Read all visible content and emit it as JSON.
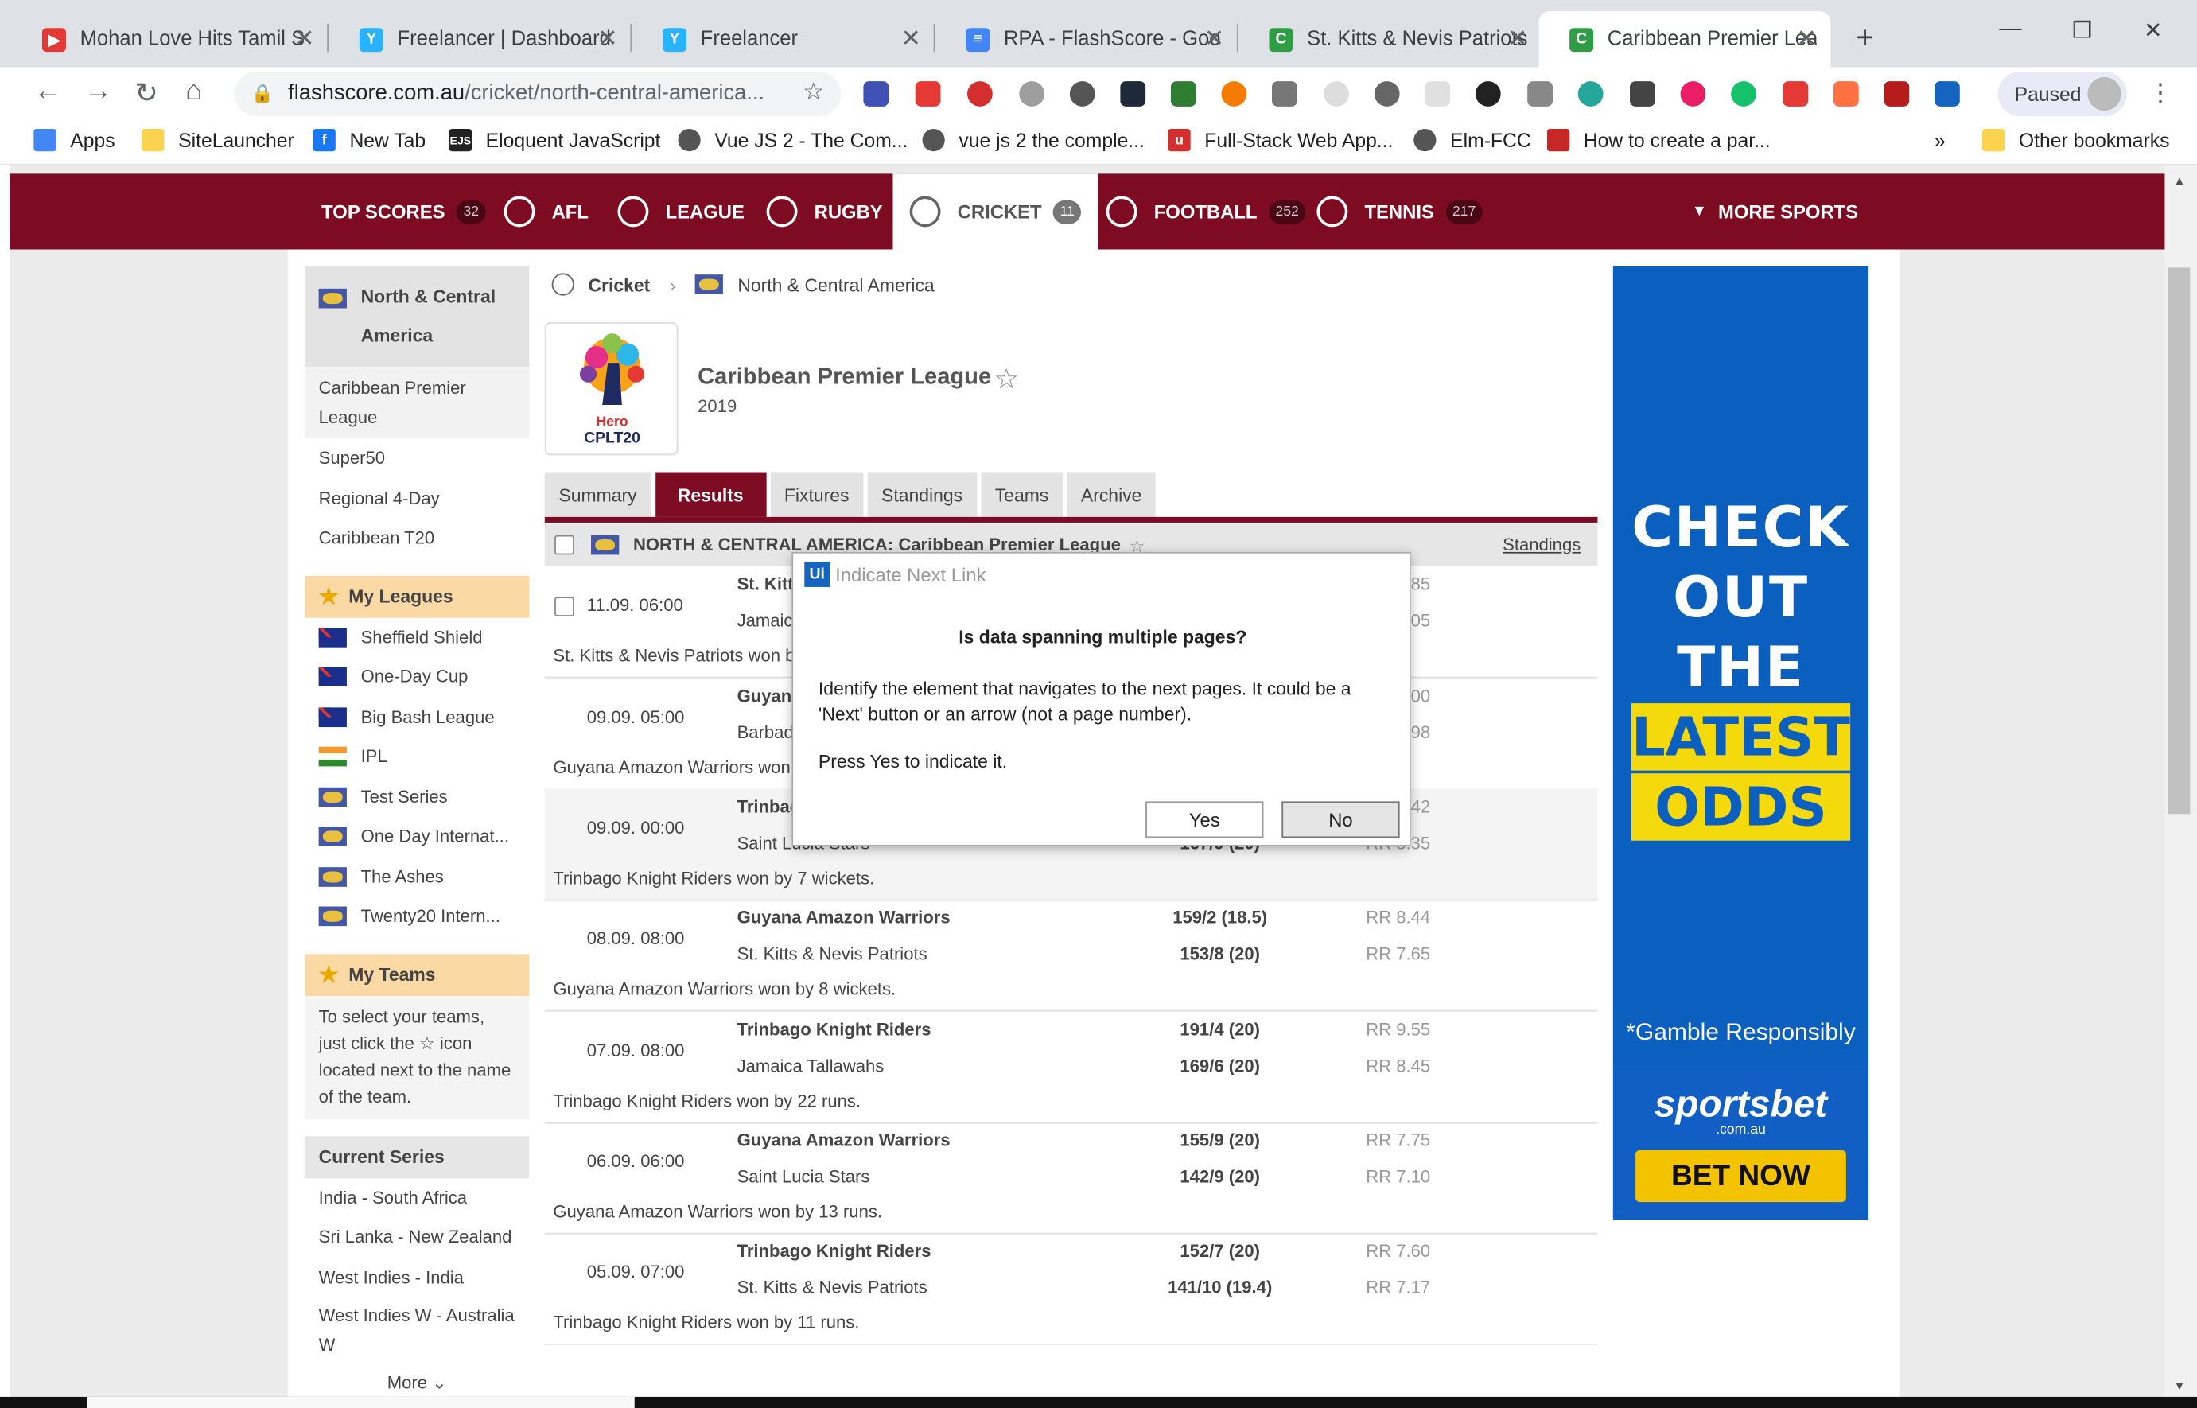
{
  "browser": {
    "tabs": [
      {
        "title": "Mohan Love Hits Tamil S",
        "color": "#e53935",
        "glyph": "▶"
      },
      {
        "title": "Freelancer | Dashboard",
        "color": "#29b2fe",
        "glyph": "Y"
      },
      {
        "title": "Freelancer",
        "color": "#29b2fe",
        "glyph": "Y"
      },
      {
        "title": "RPA - FlashScore - Goo",
        "color": "#4285f4",
        "glyph": "≡"
      },
      {
        "title": "St. Kitts & Nevis Patriots",
        "color": "#2e9e44",
        "glyph": "C"
      },
      {
        "title": "Caribbean Premier Leag",
        "color": "#2e9e44",
        "glyph": "C"
      }
    ],
    "url_domain": "flashscore.com.au",
    "url_path": "/cricket/north-central-america...",
    "profile_label": "Paused",
    "bookmarks": [
      {
        "label": "Apps",
        "color": "#4285f4"
      },
      {
        "label": "SiteLauncher",
        "color": "#fcd34d"
      },
      {
        "label": "New Tab",
        "color": "#1877f2"
      },
      {
        "label": "Eloquent JavaScript",
        "color": "#222"
      },
      {
        "label": "Vue JS 2 - The Com...",
        "color": "#555"
      },
      {
        "label": "vue js 2 the comple...",
        "color": "#555"
      },
      {
        "label": "Full-Stack Web App...",
        "color": "#d32f2f"
      },
      {
        "label": "Elm-FCC",
        "color": "#555"
      },
      {
        "label": "How to create a par...",
        "color": "#c62828"
      }
    ],
    "overflow_label": "»",
    "other_bookmarks": "Other bookmarks"
  },
  "nav": {
    "items": [
      {
        "label": "TOP SCORES",
        "count": "32"
      },
      {
        "label": "AFL",
        "count": ""
      },
      {
        "label": "LEAGUE",
        "count": ""
      },
      {
        "label": "RUGBY",
        "count": ""
      },
      {
        "label": "CRICKET",
        "count": "11"
      },
      {
        "label": "FOOTBALL",
        "count": "252"
      },
      {
        "label": "TENNIS",
        "count": "217"
      }
    ],
    "more_sports": "MORE SPORTS"
  },
  "sidebar": {
    "region": "North & Central America",
    "leagues": [
      "Caribbean Premier League",
      "Super50",
      "Regional 4-Day",
      "Caribbean T20"
    ],
    "my_leagues_title": "My Leagues",
    "my_leagues": [
      {
        "label": "Sheffield Shield",
        "flag": "au"
      },
      {
        "label": "One-Day Cup",
        "flag": "au"
      },
      {
        "label": "Big Bash League",
        "flag": "au"
      },
      {
        "label": "IPL",
        "flag": "in"
      },
      {
        "label": "Test Series",
        "flag": "world"
      },
      {
        "label": "One Day Internat...",
        "flag": "world"
      },
      {
        "label": "The Ashes",
        "flag": "world"
      },
      {
        "label": "Twenty20 Intern...",
        "flag": "world"
      }
    ],
    "my_teams_title": "My Teams",
    "my_teams_text_1": "To select your teams, just click the",
    "my_teams_text_2": "icon located next to the name of the team.",
    "current_series_title": "Current Series",
    "current_series": [
      "India - South Africa",
      "Sri Lanka - New Zealand",
      "West Indies - India",
      "West Indies W - Australia W"
    ],
    "more_label": "More"
  },
  "content": {
    "crumb_sport": "Cricket",
    "crumb_region": "North & Central America",
    "league_title": "Caribbean Premier League",
    "league_year": "2019",
    "logo_text_1": "Hero",
    "logo_text_2": "CPLT20",
    "tabs": [
      "Summary",
      "Results",
      "Fixtures",
      "Standings",
      "Teams",
      "Archive"
    ],
    "list_header": "NORTH & CENTRAL AMERICA: Caribbean Premier League",
    "standings_link": "Standings",
    "matches": [
      {
        "date": "11.09. 06:00",
        "team1": "St. Kitts & Nevis Patriots",
        "team2": "Jamaica Tallawahs",
        "score1": "",
        "score2": "",
        "rr1": "RR 8.85",
        "rr2": "RR 8.05",
        "result": "St. Kitts & Nevis Patriots won by 2 wickets."
      },
      {
        "date": "09.09. 05:00",
        "team1": "Guyana Amazon Warriors",
        "team2": "Barbados Tridents",
        "score1": "",
        "score2": "",
        "rr1": "RR 8.00",
        "rr2": "RR 7.98",
        "result": "Guyana Amazon Warriors won by 7 wickets."
      },
      {
        "date": "09.09. 00:00",
        "team1": "Trinbago Knight Riders",
        "team2": "Saint Lucia Stars",
        "score1": "",
        "score2": "167/9 (20)",
        "rr1": "RR 8.42",
        "rr2": "RR 8.35",
        "result": "Trinbago Knight Riders won by 7 wickets."
      },
      {
        "date": "08.09. 08:00",
        "team1": "Guyana Amazon Warriors",
        "team2": "St. Kitts & Nevis Patriots",
        "score1": "159/2 (18.5)",
        "score2": "153/8 (20)",
        "rr1": "RR 8.44",
        "rr2": "RR 7.65",
        "result": "Guyana Amazon Warriors won by 8 wickets."
      },
      {
        "date": "07.09. 08:00",
        "team1": "Trinbago Knight Riders",
        "team2": "Jamaica Tallawahs",
        "score1": "191/4 (20)",
        "score2": "169/6 (20)",
        "rr1": "RR 9.55",
        "rr2": "RR 8.45",
        "result": "Trinbago Knight Riders won by 22 runs."
      },
      {
        "date": "06.09. 06:00",
        "team1": "Guyana Amazon Warriors",
        "team2": "Saint Lucia Stars",
        "score1": "155/9 (20)",
        "score2": "142/9 (20)",
        "rr1": "RR 7.75",
        "rr2": "RR 7.10",
        "result": "Guyana Amazon Warriors won by 13 runs."
      },
      {
        "date": "05.09. 07:00",
        "team1": "Trinbago Knight Riders",
        "team2": "St. Kitts & Nevis Patriots",
        "score1": "152/7 (20)",
        "score2": "141/10 (19.4)",
        "rr1": "RR 7.60",
        "rr2": "RR 7.17",
        "result": "Trinbago Knight Riders won by 11 runs."
      }
    ]
  },
  "ad": {
    "line1": "CHECK",
    "line2": "OUT",
    "line3": "THE",
    "line4": "LATEST",
    "line5": "ODDS",
    "gamble": "*Gamble Responsibly",
    "brand": "sportsbet",
    "brand_domain": ".com.au",
    "cta": "BET NOW"
  },
  "dialog": {
    "badge": "Ui",
    "title": "Indicate Next Link",
    "question": "Is data spanning multiple pages?",
    "body": "Identify the element that navigates to the next pages. It could be a 'Next' button or an arrow (not a page number).",
    "prompt": "Press Yes to indicate it.",
    "yes": "Yes",
    "no": "No"
  }
}
